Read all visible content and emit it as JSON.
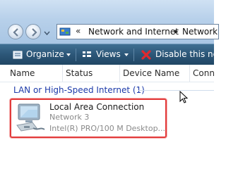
{
  "address": {
    "chevron": "«",
    "segment1": "Network and Internet",
    "separator": "▸",
    "segment2": "Network"
  },
  "toolbar": {
    "organize_label": "Organize",
    "views_label": "Views",
    "disable_label": "Disable this net"
  },
  "columns": [
    "Name",
    "Status",
    "Device Name",
    "Conn"
  ],
  "group": {
    "label": "LAN or High-Speed Internet (1)"
  },
  "connection": {
    "name": "Local Area Connection",
    "network": "Network  3",
    "device": "Intel(R) PRO/100 M Desktop..."
  },
  "icons": {
    "back": "back-arrow-icon",
    "forward": "forward-arrow-icon",
    "address": "network-folder-icon",
    "organize": "organize-icon",
    "views": "views-icon",
    "disable": "red-x-icon",
    "connection": "network-adapter-icon"
  },
  "colors": {
    "toolbar": "#2c5677",
    "group_text": "#1c3aa9",
    "highlight": "#e23b3b"
  }
}
